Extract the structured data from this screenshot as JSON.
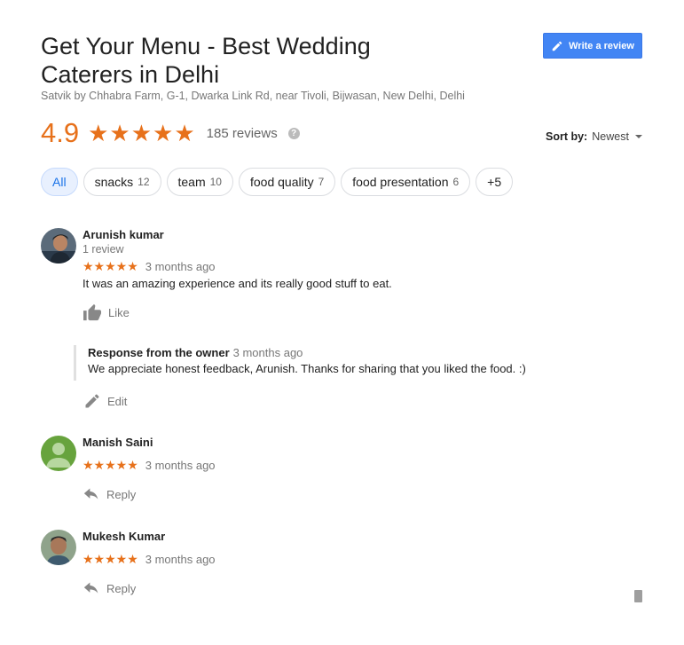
{
  "header": {
    "title": "Get Your Menu - Best Wedding Caterers in Delhi",
    "address": "Satvik by Chhabra Farm, G-1, Dwarka Link Rd, near Tivoli, Bijwasan, New Delhi, Delhi",
    "write_review_label": "Write a review"
  },
  "summary": {
    "rating": "4.9",
    "stars": "★★★★★",
    "review_count": "185 reviews",
    "help_glyph": "?"
  },
  "sort": {
    "label": "Sort by:",
    "value": "Newest"
  },
  "filters": [
    {
      "label": "All",
      "count": ""
    },
    {
      "label": "snacks",
      "count": "12"
    },
    {
      "label": "team",
      "count": "10"
    },
    {
      "label": "food quality",
      "count": "7"
    },
    {
      "label": "food presentation",
      "count": "6"
    },
    {
      "label": "+5",
      "count": ""
    }
  ],
  "reviews": [
    {
      "name": "Arunish kumar",
      "meta": "1 review",
      "stars": "★★★★★",
      "time": "3 months ago",
      "text": "It was an amazing experience and its really good stuff to eat.",
      "action_label": "Like",
      "owner_response": {
        "heading": "Response from the owner",
        "time": "3 months ago",
        "text": "We appreciate honest feedback, Arunish. Thanks for sharing that you liked the food. :)",
        "edit_label": "Edit"
      }
    },
    {
      "name": "Manish Saini",
      "stars": "★★★★★",
      "time": "3 months ago",
      "action_label": "Reply"
    },
    {
      "name": "Mukesh Kumar",
      "stars": "★★★★★",
      "time": "3 months ago",
      "action_label": "Reply"
    }
  ],
  "colors": {
    "accent_orange": "#e7711b",
    "button_blue": "#4285f4",
    "chip_active_blue": "#1a73e8"
  }
}
